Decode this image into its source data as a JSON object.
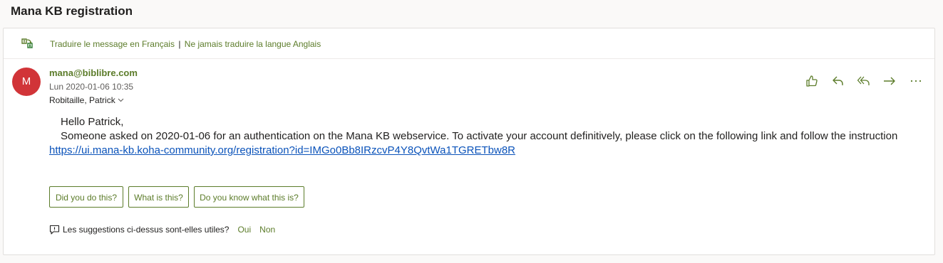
{
  "subject": "Mana KB registration",
  "translation": {
    "translate_link": "Traduire le message en Français",
    "separator": "|",
    "never_translate_link": "Ne jamais traduire la langue Anglais"
  },
  "message": {
    "avatar_initial": "M",
    "avatar_color": "#d13438",
    "sender": "mana@biblibre.com",
    "date": "Lun 2020-01-06 10:35",
    "recipient": "Robitaille, Patrick",
    "greeting": "Hello Patrick,",
    "body_line": "Someone asked on 2020-01-06 for an authentication on the Mana KB webservice. To activate your account definitively, please click on the following link and follow the instruction",
    "link": "https://ui.mana-kb.koha-community.org/registration?id=IMGo0Bb8IRzcvP4Y8QvtWa1TGRETbw8R"
  },
  "actions": [
    "like-icon",
    "reply-icon",
    "reply-all-icon",
    "forward-icon",
    "more-icon"
  ],
  "suggested_replies": [
    "Did you do this?",
    "What is this?",
    "Do you know what this is?"
  ],
  "feedback": {
    "question": "Les suggestions ci-dessus sont-elles utiles?",
    "yes": "Oui",
    "no": "Non"
  },
  "colors": {
    "accent": "#5c7c2a",
    "link": "#0b53ba",
    "background": "#faf9f8"
  }
}
